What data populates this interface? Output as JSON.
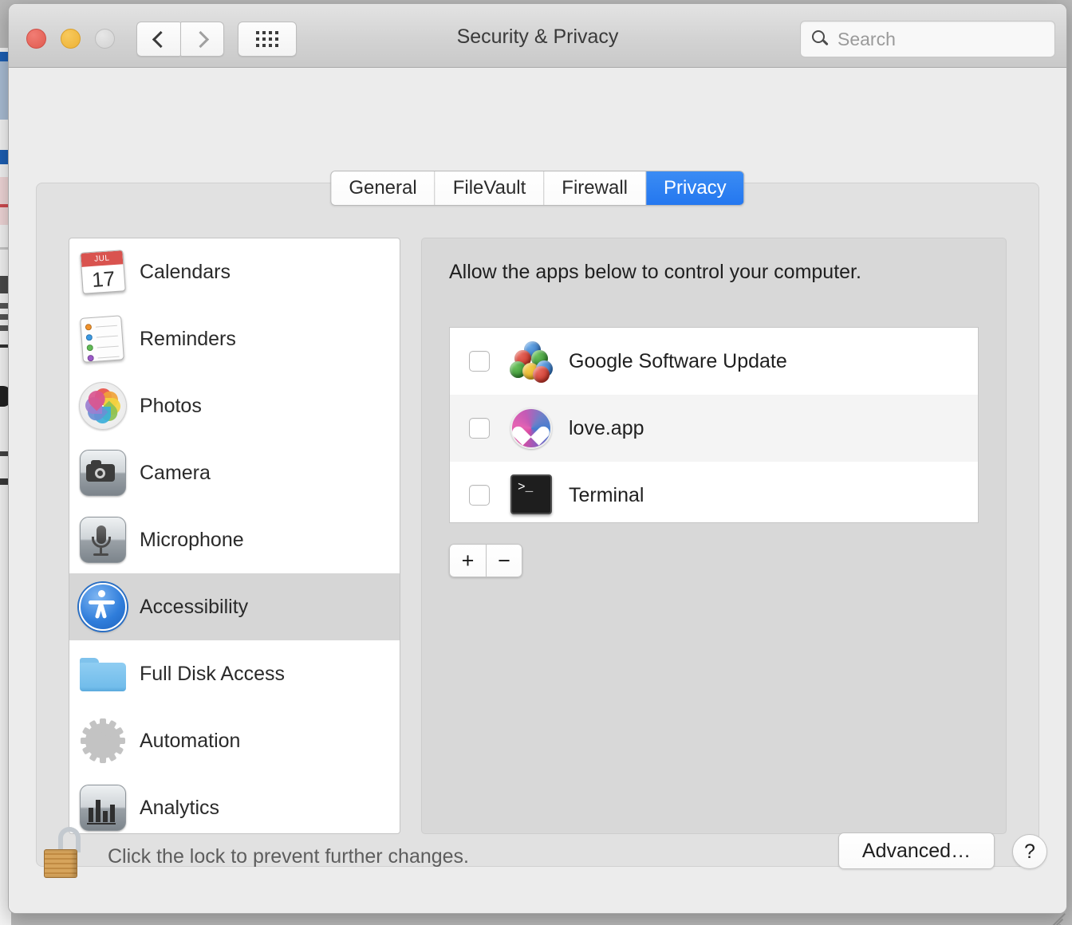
{
  "window": {
    "title": "Security & Privacy",
    "traffic_lights": [
      "close",
      "minimize",
      "zoom"
    ],
    "nav": {
      "back_label": "Back",
      "forward_label": "Forward",
      "grid_label": "Show All"
    },
    "search": {
      "placeholder": "Search",
      "value": ""
    }
  },
  "tabs": [
    {
      "label": "General",
      "selected": false
    },
    {
      "label": "FileVault",
      "selected": false
    },
    {
      "label": "Firewall",
      "selected": false
    },
    {
      "label": "Privacy",
      "selected": true
    }
  ],
  "sidebar": {
    "items": [
      {
        "label": "Calendars",
        "icon": "calendar-icon",
        "selected": false
      },
      {
        "label": "Reminders",
        "icon": "reminders-icon",
        "selected": false
      },
      {
        "label": "Photos",
        "icon": "photos-icon",
        "selected": false
      },
      {
        "label": "Camera",
        "icon": "camera-icon",
        "selected": false
      },
      {
        "label": "Microphone",
        "icon": "microphone-icon",
        "selected": false
      },
      {
        "label": "Accessibility",
        "icon": "accessibility-icon",
        "selected": true
      },
      {
        "label": "Full Disk Access",
        "icon": "folder-icon",
        "selected": false
      },
      {
        "label": "Automation",
        "icon": "gear-icon",
        "selected": false
      },
      {
        "label": "Analytics",
        "icon": "analytics-icon",
        "selected": false
      }
    ]
  },
  "content": {
    "note": "Allow the apps below to control your computer.",
    "apps": [
      {
        "name": "Google Software Update",
        "checked": false,
        "icon": "google-software-update-icon"
      },
      {
        "name": "love.app",
        "checked": false,
        "icon": "love-app-icon"
      },
      {
        "name": "Terminal",
        "checked": false,
        "icon": "terminal-icon"
      }
    ],
    "add_label": "+",
    "remove_label": "−"
  },
  "footer": {
    "lock_text": "Click the lock to prevent further changes.",
    "lock_state": "unlocked",
    "advanced_label": "Advanced…",
    "help_label": "?"
  },
  "calendar_icon": {
    "month": "JUL",
    "day": "17"
  },
  "terminal_icon": {
    "prompt": ">_"
  },
  "colors": {
    "accent_blue": "#2477ef",
    "window_bg": "#ececec",
    "panel_bg": "#e1e1e1",
    "content_bg": "#d8d8d8",
    "selection_gray": "#d6d6d6",
    "list_white": "#ffffff",
    "list_alt": "#f4f4f4",
    "calendar_red": "#d9534f",
    "folder_blue": "#72bdeb",
    "lock_gold": "#d6a45c"
  }
}
